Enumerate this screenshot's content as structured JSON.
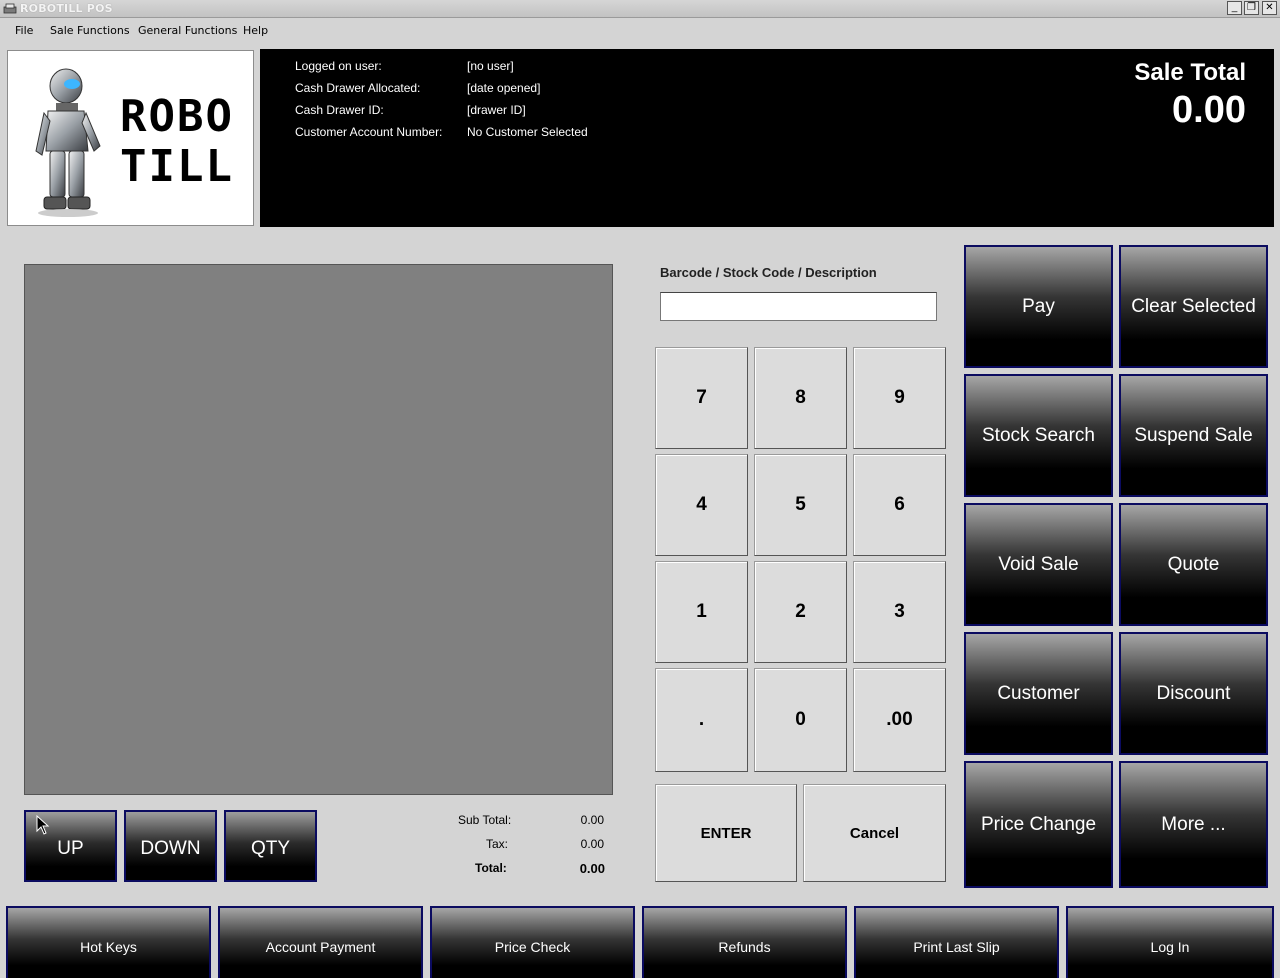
{
  "window": {
    "title": "ROBOTILL POS",
    "buttons": {
      "minimize": "_",
      "restore": "❐",
      "close": "✕"
    }
  },
  "menu": [
    "File",
    "Sale Functions",
    "General Functions",
    "Help"
  ],
  "header": {
    "info": [
      {
        "label": "Logged on user:",
        "value": "[no user]"
      },
      {
        "label": "Cash Drawer Allocated:",
        "value": "[date opened]"
      },
      {
        "label": "Cash Drawer ID:",
        "value": "[drawer ID]"
      },
      {
        "label": "Customer Account Number:",
        "value": "No Customer Selected"
      }
    ],
    "sale_total_label": "Sale Total",
    "sale_total_value": "0.00",
    "logo_text": [
      "ROBO",
      "TILL"
    ]
  },
  "nav_buttons": [
    "UP",
    "DOWN",
    "QTY"
  ],
  "totals": [
    {
      "label": "Sub Total:",
      "value": "0.00"
    },
    {
      "label": "Tax:",
      "value": "0.00"
    },
    {
      "label": "Total:",
      "value": "0.00"
    }
  ],
  "barcode": {
    "label": "Barcode / Stock Code / Description",
    "value": ""
  },
  "keypad": [
    "7",
    "8",
    "9",
    "4",
    "5",
    "6",
    "1",
    "2",
    "3",
    ".",
    "0",
    ".00"
  ],
  "keypad_actions": {
    "enter": "ENTER",
    "cancel": "Cancel"
  },
  "function_buttons": [
    "Pay",
    "Clear Selected",
    "Stock Search",
    "Suspend Sale",
    "Void Sale",
    "Quote",
    "Customer",
    "Discount",
    "Price Change",
    "More ..."
  ],
  "bottom_buttons": [
    "Hot Keys",
    "Account Payment",
    "Price Check",
    "Refunds",
    "Print Last Slip",
    "Log In"
  ],
  "colors": {
    "button_border": "#0b0b60",
    "header_bg": "#000000",
    "grid_bg": "#808080",
    "window_bg": "#d4d4d4"
  }
}
